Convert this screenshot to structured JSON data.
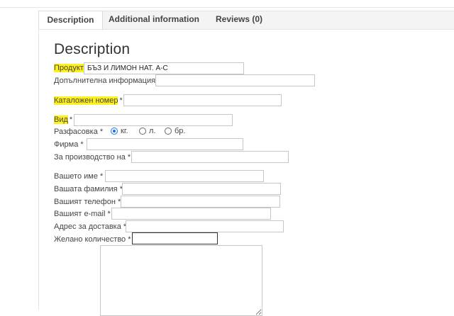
{
  "tabs": [
    {
      "label": "Description",
      "active": true
    },
    {
      "label": "Additional information",
      "active": false
    },
    {
      "label": "Reviews (0)",
      "active": false
    }
  ],
  "section_title": "Description",
  "highlight_color": "#fff11b",
  "fields": {
    "product": {
      "label": "Продукт",
      "value": "БЪЗ И ЛИМОН НАТ. А-С"
    },
    "additional_info": {
      "label": "Допълнителна информация",
      "value": ""
    },
    "catalog_number": {
      "label": "Каталожен номер",
      "required": "*",
      "value": ""
    },
    "kind": {
      "label": "Вид",
      "required": "*",
      "value": ""
    },
    "packaging": {
      "label": "Разфасовка *",
      "options": [
        {
          "label": "кг.",
          "checked": true
        },
        {
          "label": "л.",
          "checked": false
        },
        {
          "label": "бр.",
          "checked": false
        }
      ]
    },
    "company": {
      "label": "Фирма *",
      "value": ""
    },
    "for_production": {
      "label": "За производство на *",
      "value": ""
    },
    "your_name": {
      "label": "Вашето име *",
      "value": ""
    },
    "your_surname": {
      "label": "Вашата фамилия *",
      "value": ""
    },
    "your_phone": {
      "label": "Вашият телефон *",
      "value": ""
    },
    "your_email": {
      "label": "Вашият e-mail *",
      "value": ""
    },
    "delivery_address": {
      "label": "Адрес за доставка *",
      "value": ""
    },
    "desired_quantity": {
      "label": "Желано количество *",
      "value": ""
    }
  },
  "message": {
    "value": ""
  }
}
